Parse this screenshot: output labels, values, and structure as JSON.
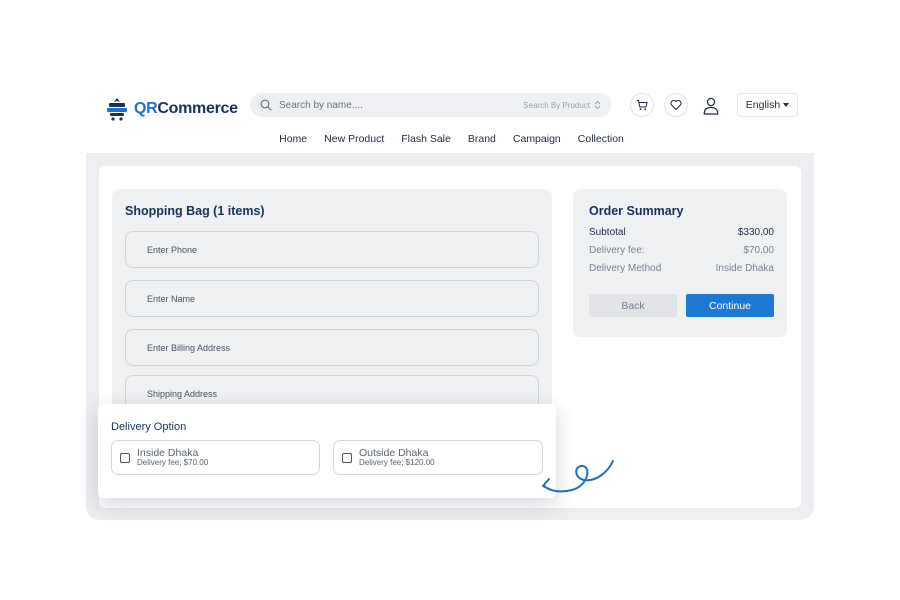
{
  "brand": {
    "name_prefix": "QR",
    "name_suffix": "Commerce"
  },
  "search": {
    "placeholder": "Search by name....",
    "category": "Search By Product"
  },
  "header_icons": [
    "cart-icon",
    "heart-icon",
    "user-icon"
  ],
  "language": "English",
  "nav": [
    "Home",
    "New Product",
    "Flash Sale",
    "Brand",
    "Campaign",
    "Collection"
  ],
  "bag": {
    "title": "Shopping Bag (1 items)",
    "fields": [
      "Enter Phone",
      "Enter Name",
      "Enter Billing Address",
      "Shipping Address"
    ]
  },
  "summary": {
    "title": "Order Summary",
    "rows": [
      {
        "label": "Subtotal",
        "value": "$330.00"
      },
      {
        "label": "Delivery fee:",
        "value": "$70.00"
      },
      {
        "label": "Delivery Method",
        "value": "Inside Dhaka"
      }
    ],
    "back_label": "Back",
    "continue_label": "Continue"
  },
  "delivery": {
    "title": "Delivery Option",
    "options": [
      {
        "name": "Inside Dhaka",
        "fee": "Delivery fee; $70.00"
      },
      {
        "name": "Outside Dhaka",
        "fee": "Delivery fee; $120.00"
      }
    ]
  },
  "colors": {
    "brand": "#16325c",
    "accent": "#1c79d6",
    "panel": "#f0f1f3"
  }
}
